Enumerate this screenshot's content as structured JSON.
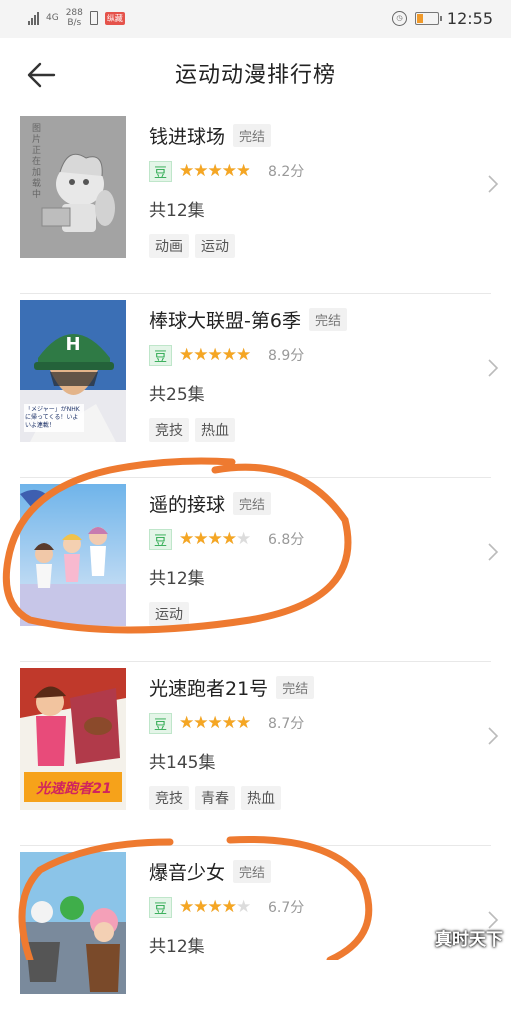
{
  "status_bar": {
    "network_label": "4G",
    "speed_value": "288",
    "speed_unit": "B/s",
    "badge": "纵藏",
    "time": "12:55"
  },
  "header": {
    "title": "运动动漫排行榜"
  },
  "items": [
    {
      "title": "钱进球场",
      "status": "完结",
      "rating_source": "豆",
      "rating": 8.2,
      "score": "8.2分",
      "episodes": "共12集",
      "tags": [
        "动画",
        "运动"
      ],
      "cover_text": "图片正在加载中"
    },
    {
      "title": "棒球大联盟-第6季",
      "status": "完结",
      "rating_source": "豆",
      "rating": 8.9,
      "score": "8.9分",
      "episodes": "共25集",
      "tags": [
        "竞技",
        "热血"
      ],
      "cover_text": "「メジャー」がNHKに帰ってくる！いよいよ連載！"
    },
    {
      "title": "遥的接球",
      "status": "完结",
      "rating_source": "豆",
      "rating": 6.8,
      "score": "6.8分",
      "episodes": "共12集",
      "tags": [
        "运动"
      ]
    },
    {
      "title": "光速跑者21号",
      "status": "完结",
      "rating_source": "豆",
      "rating": 8.7,
      "score": "8.7分",
      "episodes": "共145集",
      "tags": [
        "竞技",
        "青春",
        "热血"
      ],
      "cover_text": "光速跑者21"
    },
    {
      "title": "爆音少女",
      "status": "完结",
      "rating_source": "豆",
      "rating": 6.7,
      "score": "6.7分",
      "episodes": "共12集",
      "tags": []
    }
  ],
  "watermark": "真时天下",
  "colors": {
    "star": "#f5a623",
    "douban_green": "#29a84d",
    "annotation": "#ee7a30"
  }
}
